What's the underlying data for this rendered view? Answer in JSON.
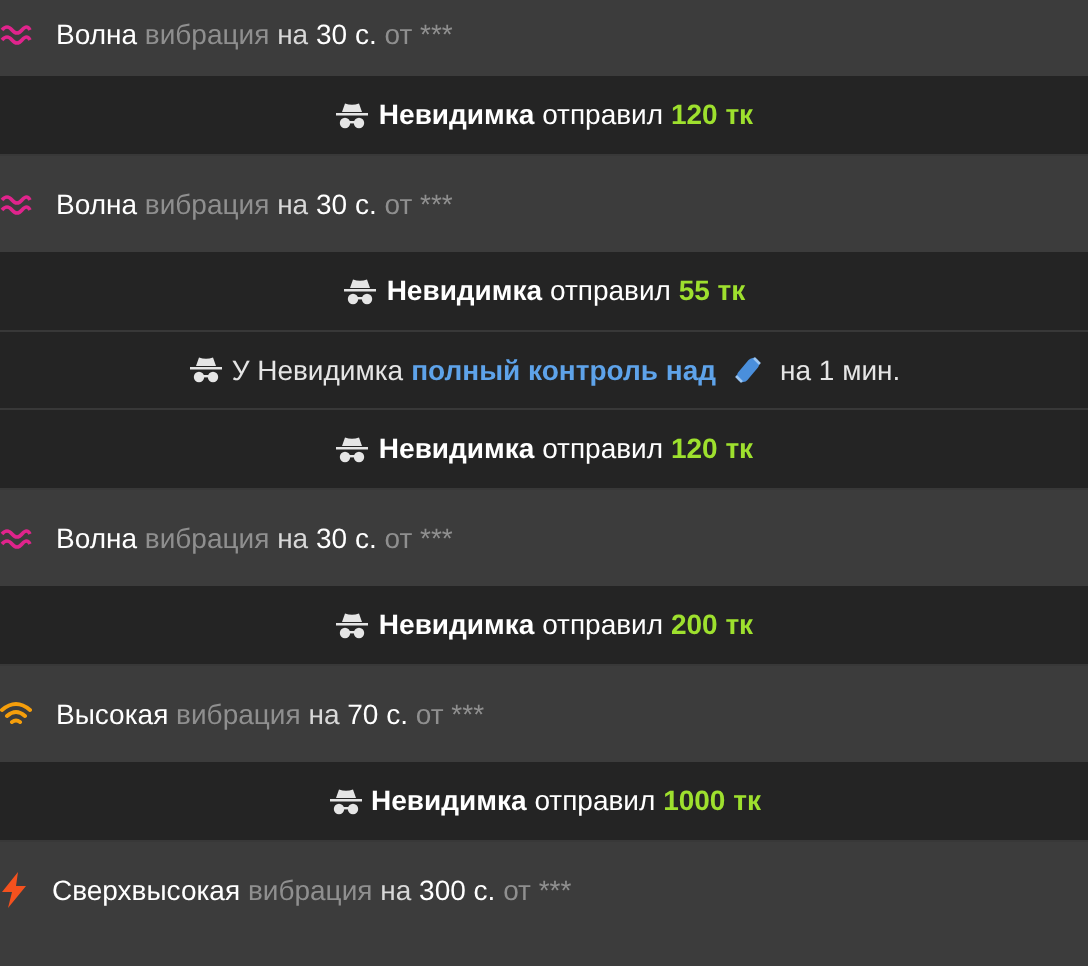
{
  "feed": [
    {
      "kind": "wave",
      "strength": "Волна",
      "word": "вибрация",
      "on": "на",
      "duration": "30 с.",
      "from": "от ***"
    },
    {
      "kind": "tip",
      "user": "Невидимка",
      "verb": "отправил",
      "amount": "120 тк"
    },
    {
      "kind": "wave",
      "strength": "Волна",
      "word": "вибрация",
      "on": "на",
      "duration": "30 с.",
      "from": "от ***"
    },
    {
      "kind": "tip",
      "user": "Невидимка",
      "verb": "отправил",
      "amount": "55 тк"
    },
    {
      "kind": "control",
      "lead": "У Невидимка",
      "action": "полный контроль над",
      "tail": "на 1 мин."
    },
    {
      "kind": "tip",
      "user": "Невидимка",
      "verb": "отправил",
      "amount": "120 тк"
    },
    {
      "kind": "wave",
      "strength": "Волна",
      "word": "вибрация",
      "on": "на",
      "duration": "30 с.",
      "from": "от ***"
    },
    {
      "kind": "tip",
      "user": "Невидимка",
      "verb": "отправил",
      "amount": "200 тк"
    },
    {
      "kind": "high",
      "strength": "Высокая",
      "word": "вибрация",
      "on": "на",
      "duration": "70 с.",
      "from": "от ***"
    },
    {
      "kind": "tip",
      "user": "Невидимка",
      "verb": "отправил",
      "amount": "1000 тк"
    },
    {
      "kind": "ultra",
      "strength": "Сверхвысокая",
      "word": "вибрация",
      "on": "на",
      "duration": "300 с.",
      "from": "от ***"
    }
  ]
}
